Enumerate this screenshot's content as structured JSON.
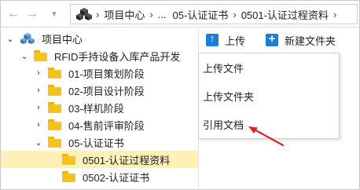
{
  "nav": {
    "back_icon": "arrow-left-icon",
    "forward_icon": "arrow-right-icon",
    "history_icon": "chevron-down-icon"
  },
  "breadcrumb": {
    "icon": "project-icon",
    "items": [
      "项目中心",
      "...",
      "05-认证证书",
      "0501-认证过程资料"
    ],
    "separator": "›"
  },
  "tree": {
    "items": [
      {
        "label": "项目中心",
        "expanded": true,
        "icon": "project-icon"
      },
      {
        "label": "RFID手持设备入库产品开发",
        "expanded": true,
        "icon": "folder-icon"
      },
      {
        "label": "01-项目策划阶段",
        "expanded": false,
        "icon": "folder-icon"
      },
      {
        "label": "02-项目设计阶段",
        "expanded": false,
        "icon": "folder-icon"
      },
      {
        "label": "03-样机阶段",
        "expanded": false,
        "icon": "folder-icon"
      },
      {
        "label": "04-售前评审阶段",
        "expanded": false,
        "icon": "folder-icon"
      },
      {
        "label": "05-认证证书",
        "expanded": true,
        "icon": "folder-icon"
      },
      {
        "label": "0501-认证过程资料",
        "selected": true,
        "icon": "folder-icon"
      },
      {
        "label": "0502-认证证书",
        "icon": "folder-icon"
      }
    ]
  },
  "toolbar": {
    "upload_label": "上传",
    "new_folder_label": "新建文件夹"
  },
  "menu": {
    "items": [
      "上传文件",
      "上传文件夹",
      "引用文档"
    ]
  },
  "colors": {
    "selected_bg": "#fdf0b8",
    "folder": "#f7c21a",
    "accent": "#1a7ed6",
    "annotation_arrow": "#d9262a"
  }
}
